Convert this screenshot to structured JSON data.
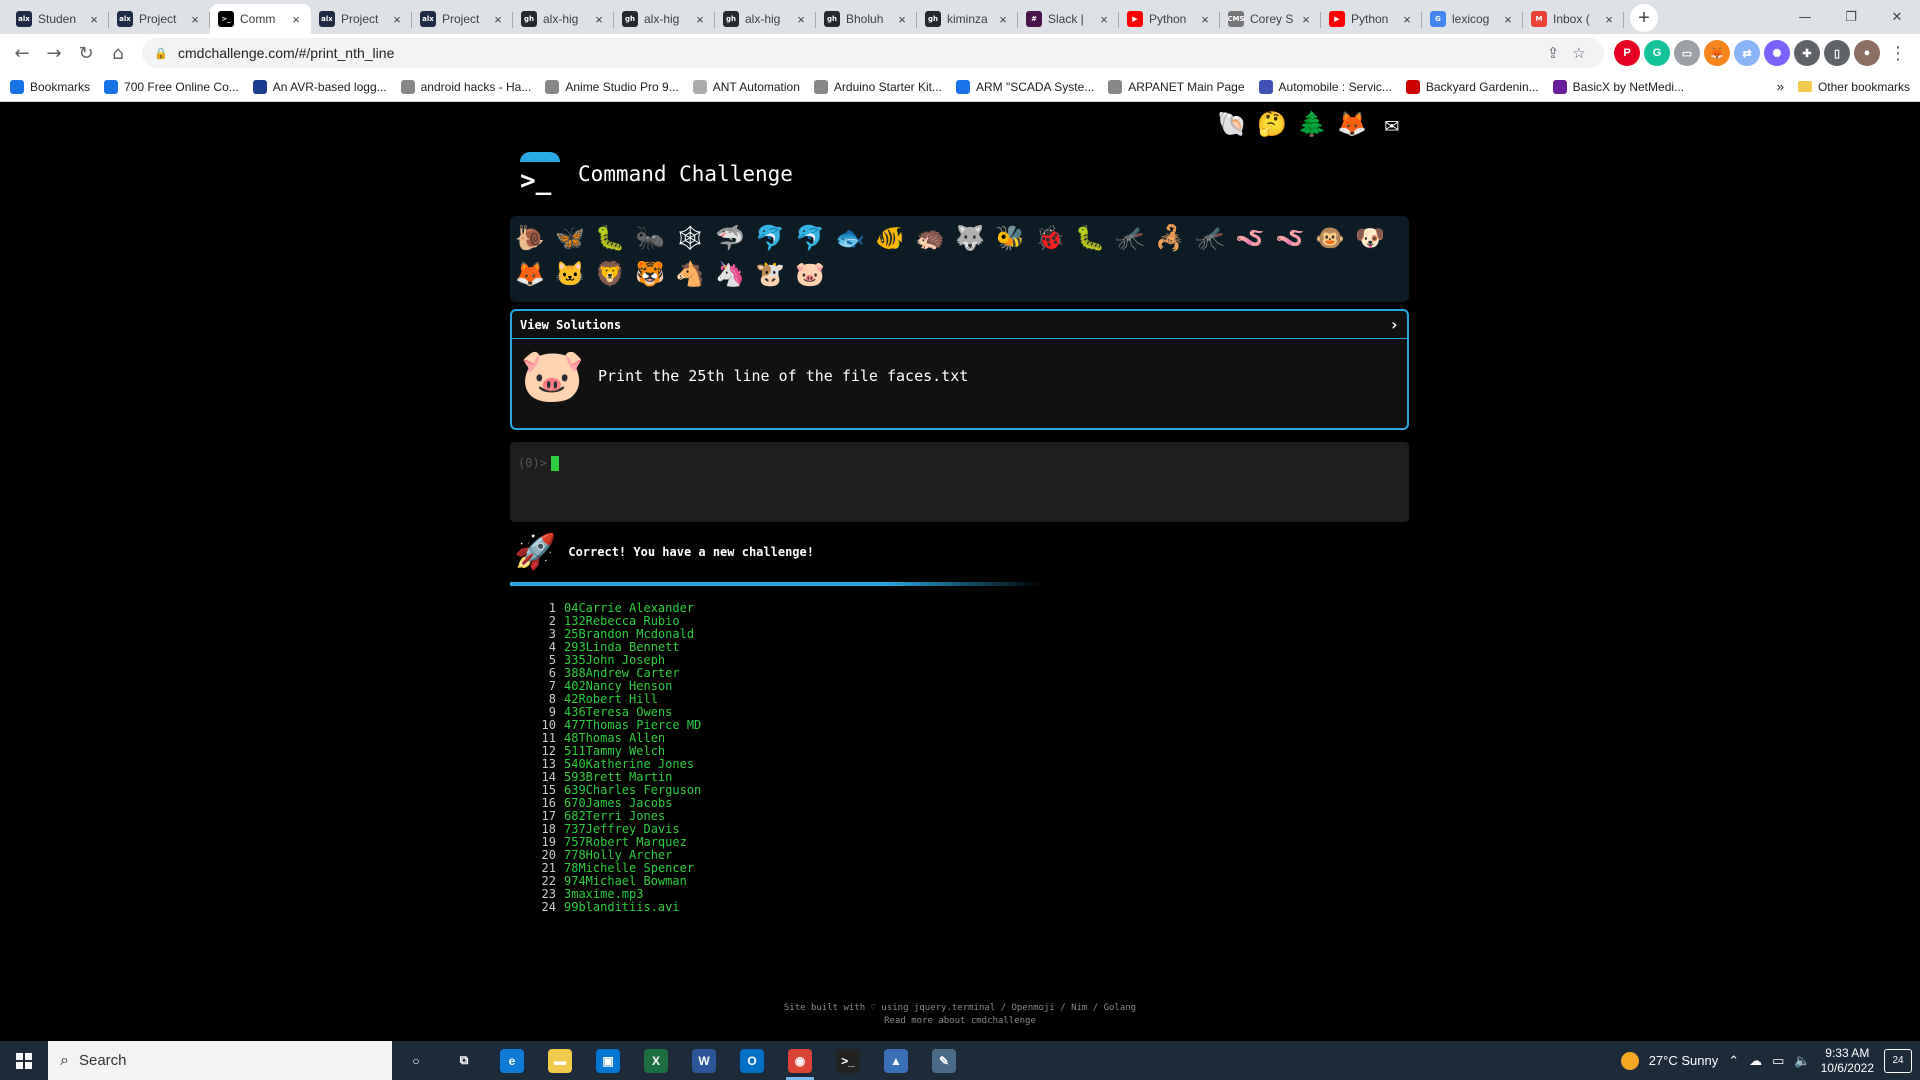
{
  "browser": {
    "tabs": [
      {
        "title": "Studen",
        "favicon": "alx",
        "color": "#1f2a44"
      },
      {
        "title": "Project",
        "favicon": "alx",
        "color": "#1f2a44"
      },
      {
        "title": "Comm",
        "favicon": ">_",
        "color": "#000000"
      },
      {
        "title": "Project",
        "favicon": "alx",
        "color": "#1f2a44"
      },
      {
        "title": "Project",
        "favicon": "alx",
        "color": "#1f2a44"
      },
      {
        "title": "alx-hig",
        "favicon": "gh",
        "color": "#24292e"
      },
      {
        "title": "alx-hig",
        "favicon": "gh",
        "color": "#24292e"
      },
      {
        "title": "alx-hig",
        "favicon": "gh",
        "color": "#24292e"
      },
      {
        "title": "Bholuh",
        "favicon": "gh",
        "color": "#24292e"
      },
      {
        "title": "kiminza",
        "favicon": "gh",
        "color": "#24292e"
      },
      {
        "title": "Slack |",
        "favicon": "#",
        "color": "#4a154b"
      },
      {
        "title": "Python",
        "favicon": "▶",
        "color": "#ff0000"
      },
      {
        "title": "Corey S",
        "favicon": "CMS",
        "color": "#777777"
      },
      {
        "title": "Python",
        "favicon": "▶",
        "color": "#ff0000"
      },
      {
        "title": "lexicog",
        "favicon": "G",
        "color": "#4285f4"
      },
      {
        "title": "Inbox (",
        "favicon": "M",
        "color": "#ea4335"
      }
    ],
    "active_tab_index": 2,
    "url": "cmdchallenge.com/#/print_nth_line",
    "window_controls": {
      "minimize": "—",
      "maximize": "❐",
      "close": "✕"
    },
    "nav": {
      "back": "←",
      "forward": "→",
      "reload": "↻",
      "home": "⌂"
    },
    "bookmarks": [
      {
        "label": "Bookmarks",
        "color": "#1a73e8"
      },
      {
        "label": "700 Free Online Co...",
        "color": "#1a73e8"
      },
      {
        "label": "An AVR-based logg...",
        "color": "#1a3d8f"
      },
      {
        "label": "android hacks - Ha...",
        "color": "#888888"
      },
      {
        "label": "Anime Studio Pro 9...",
        "color": "#888888"
      },
      {
        "label": "ANT Automation",
        "color": "#aaaaaa"
      },
      {
        "label": "Arduino Starter Kit...",
        "color": "#888888"
      },
      {
        "label": "ARM \"SCADA Syste...",
        "color": "#1a73e8"
      },
      {
        "label": "ARPANET Main Page",
        "color": "#888888"
      },
      {
        "label": "Automobile : Servic...",
        "color": "#3f51b5"
      },
      {
        "label": "Backyard Gardenin...",
        "color": "#cc0000"
      },
      {
        "label": "BasicX by NetMedi...",
        "color": "#6a1b9a"
      }
    ],
    "bookmarks_more": "»",
    "other_bookmarks": "Other bookmarks"
  },
  "page": {
    "title": "Command Challenge",
    "top_icons": [
      "🐚",
      "🤔",
      "🌲",
      "🦊",
      "✉"
    ],
    "animals": [
      "🐌",
      "🦋",
      "🐛",
      "🐜",
      "🕸",
      "🦈",
      "🐬",
      "🐬",
      "🐟",
      "🐠",
      "🦔",
      "🐺",
      "🐝",
      "🐞",
      "🐛",
      "🦟",
      "🦂",
      "🦟",
      "🪱",
      "🪱",
      "🐵",
      "🐶",
      "🦊",
      "🐱",
      "🦁",
      "🐯",
      "🐴",
      "🦄",
      "🐮",
      "🐷"
    ],
    "solutions_label": "View Solutions",
    "solutions_chevron": "›",
    "challenge_icon": "🐷",
    "challenge_text": "Print the 25th line of the file faces.txt",
    "prompt": "(0)>",
    "success_icon": "🚀",
    "success_text": "Correct! You have a new challenge!",
    "output_lines": [
      "04Carrie Alexander",
      "132Rebecca Rubio",
      "25Brandon Mcdonald",
      "293Linda Bennett",
      "335John Joseph",
      "388Andrew Carter",
      "402Nancy Henson",
      "42Robert Hill",
      "436Teresa Owens",
      "477Thomas Pierce MD",
      "48Thomas Allen",
      "511Tammy Welch",
      "540Katherine Jones",
      "593Brett Martin",
      "639Charles Ferguson",
      "670James Jacobs",
      "682Terri Jones",
      "737Jeffrey Davis",
      "757Robert Marquez",
      "778Holly Archer",
      "78Michelle Spencer",
      "974Michael Bowman",
      "3maxime.mp3",
      "99blanditiis.avi"
    ],
    "footer_line1": "Site built with ♡ using jquery.terminal / Openmoji / Nim / Golang",
    "footer_line2": "Read more about cmdchallenge"
  },
  "taskbar": {
    "search_placeholder": "Search",
    "apps": [
      {
        "name": "task-view",
        "glyph": "○",
        "color": "transparent"
      },
      {
        "name": "widgets",
        "glyph": "⧉",
        "color": "transparent"
      },
      {
        "name": "edge",
        "glyph": "e",
        "color": "#0f7bd7"
      },
      {
        "name": "file-explorer",
        "glyph": "▬",
        "color": "#f2c94c"
      },
      {
        "name": "store",
        "glyph": "▣",
        "color": "#0078d4"
      },
      {
        "name": "excel",
        "glyph": "X",
        "color": "#1d6f42"
      },
      {
        "name": "word",
        "glyph": "W",
        "color": "#2b579a"
      },
      {
        "name": "outlook",
        "glyph": "O",
        "color": "#0072c6"
      },
      {
        "name": "chrome",
        "glyph": "◉",
        "color": "#db4437"
      },
      {
        "name": "terminal",
        "glyph": ">_",
        "color": "#222222"
      },
      {
        "name": "app-1",
        "glyph": "▲",
        "color": "#3a6fb5"
      },
      {
        "name": "app-2",
        "glyph": "✎",
        "color": "#4a6a8a"
      }
    ],
    "weather": "27°C  Sunny",
    "time": "9:33 AM",
    "date": "10/6/2022",
    "notifications": "24"
  }
}
